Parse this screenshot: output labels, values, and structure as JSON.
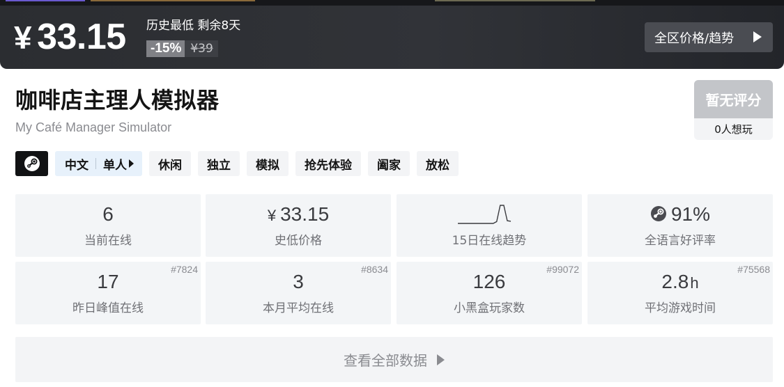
{
  "banner": {
    "currency": "¥",
    "price": "33.15",
    "price_note": "历史最低 剩余8天",
    "discount": "-15%",
    "original_price": "¥39",
    "region_button_label": "全区价格/趋势"
  },
  "game": {
    "title": "咖啡店主理人模拟器",
    "subtitle": "My Café Manager Simulator"
  },
  "score": {
    "label": "暂无评分",
    "wishlist": "0人想玩"
  },
  "tags": {
    "platform_icon": "steam-icon",
    "language": "中文",
    "players": "单人",
    "genres": [
      "休闲",
      "独立",
      "模拟",
      "抢先体验",
      "阖家",
      "放松"
    ]
  },
  "stats": {
    "current_online": {
      "value": "6",
      "label": "当前在线"
    },
    "lowest_price": {
      "currency": "¥",
      "value": "33.15",
      "label": "史低价格"
    },
    "trend": {
      "label": "15日在线趋势",
      "values": [
        0,
        0,
        0,
        0,
        0,
        0,
        0,
        0,
        0,
        0,
        0,
        0.1,
        1,
        1,
        0.15,
        0.12
      ]
    },
    "positive_rate": {
      "value": "91%",
      "label": "全语言好评率",
      "icon": "steam-icon"
    },
    "yesterday_peak": {
      "value": "17",
      "label": "昨日峰值在线",
      "rank": "#7824"
    },
    "monthly_avg": {
      "value": "3",
      "label": "本月平均在线",
      "rank": "#8634"
    },
    "heybox_players": {
      "value": "126",
      "label": "小黑盒玩家数",
      "rank": "#99072"
    },
    "avg_playtime": {
      "value": "2.8",
      "unit": "h",
      "label": "平均游戏时间",
      "rank": "#75568"
    }
  },
  "footer": {
    "all_data_label": "查看全部数据"
  },
  "colors": {
    "banner_bg": "#2f3136",
    "discount_bg": "#808186",
    "tag_bg": "#f3f4f6",
    "lang_tag_bg": "#e7f1fb",
    "stat_bg": "#f3f5f7"
  }
}
